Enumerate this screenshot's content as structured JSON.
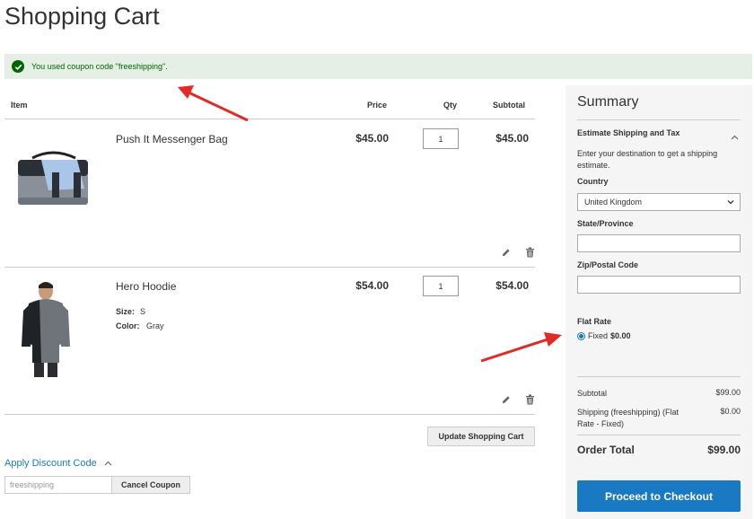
{
  "page": {
    "title": "Shopping Cart"
  },
  "message": {
    "text": "You used coupon code \"freeshipping\"."
  },
  "table": {
    "headers": {
      "item": "Item",
      "price": "Price",
      "qty": "Qty",
      "subtotal": "Subtotal"
    },
    "rows": [
      {
        "name": "Push It Messenger Bag",
        "price": "$45.00",
        "qty": "1",
        "subtotal": "$45.00"
      },
      {
        "name": "Hero Hoodie",
        "price": "$54.00",
        "qty": "1",
        "subtotal": "$54.00",
        "options": [
          {
            "label": "Size:",
            "value": "S"
          },
          {
            "label": "Color:",
            "value": "Gray"
          }
        ]
      }
    ]
  },
  "actions": {
    "update_label": "Update Shopping Cart"
  },
  "discount": {
    "title": "Apply Discount Code",
    "value": "freeshipping",
    "cancel_label": "Cancel Coupon"
  },
  "summary": {
    "title": "Summary",
    "estimate_title": "Estimate Shipping and Tax",
    "estimate_text": "Enter your destination to get a shipping estimate.",
    "country_label": "Country",
    "country_value": "United Kingdom",
    "state_label": "State/Province",
    "zip_label": "Zip/Postal Code",
    "flat_rate_label": "Flat Rate",
    "fixed_label": "Fixed",
    "fixed_value": "$0.00",
    "subtotal_label": "Subtotal",
    "subtotal_value": "$99.00",
    "shipping_label": "Shipping (freeshipping) (Flat Rate - Fixed)",
    "shipping_value": "$0.00",
    "order_total_label": "Order Total",
    "order_total_value": "$99.00",
    "checkout_label": "Proceed to Checkout"
  },
  "colors": {
    "accent": "#1979c3",
    "success_bg": "#e5efe5",
    "success_text": "#006400",
    "arrow": "#e02b27"
  }
}
